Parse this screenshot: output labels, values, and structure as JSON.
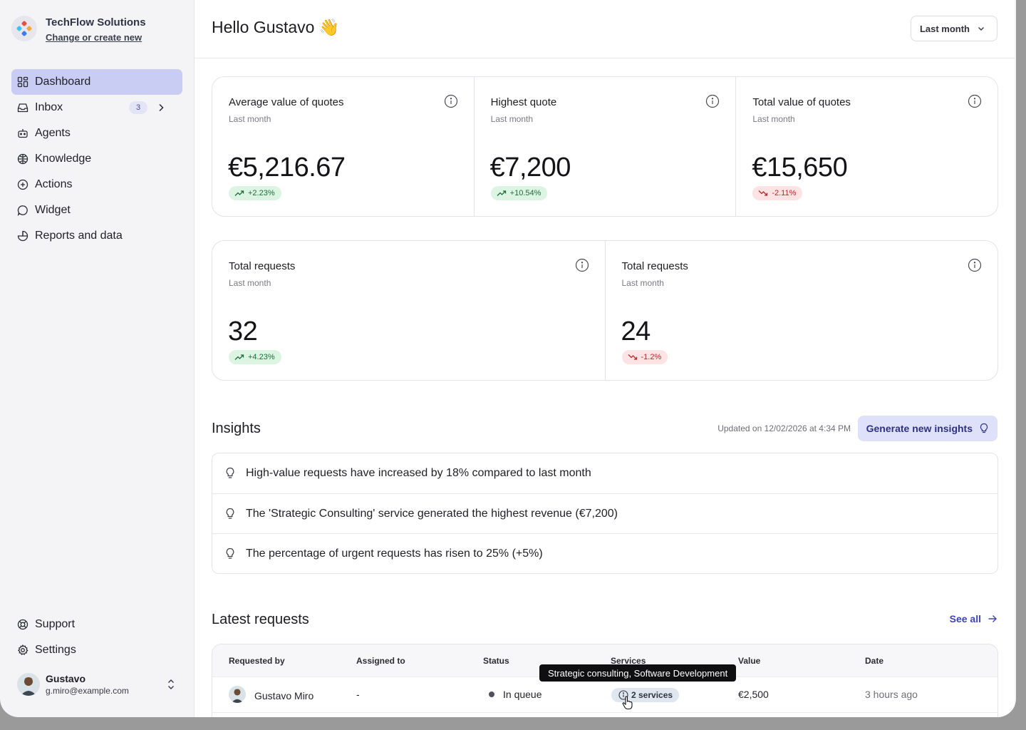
{
  "org": {
    "name": "TechFlow Solutions",
    "change_link": "Change or create new"
  },
  "nav": {
    "items": [
      {
        "label": "Dashboard",
        "icon": "dashboard-icon",
        "active": true
      },
      {
        "label": "Inbox",
        "icon": "inbox-icon",
        "badge": "3"
      },
      {
        "label": "Agents",
        "icon": "agents-icon"
      },
      {
        "label": "Knowledge",
        "icon": "knowledge-icon"
      },
      {
        "label": "Actions",
        "icon": "plus-circle-icon"
      },
      {
        "label": "Widget",
        "icon": "chat-bubble-icon"
      },
      {
        "label": "Reports and data",
        "icon": "pie-chart-icon"
      }
    ],
    "bottom": [
      {
        "label": "Support",
        "icon": "support-icon"
      },
      {
        "label": "Settings",
        "icon": "gear-icon"
      }
    ]
  },
  "user": {
    "name": "Gustavo",
    "email": "g.miro@example.com"
  },
  "header": {
    "greeting": "Hello Gustavo",
    "wave": "👋",
    "period": "Last month"
  },
  "kpis_top": [
    {
      "title": "Average value of quotes",
      "sub": "Last month",
      "value": "€5,216.67",
      "delta": "+2.23%",
      "trend": "up"
    },
    {
      "title": "Highest quote",
      "sub": "Last month",
      "value": "€7,200",
      "delta": "+10.54%",
      "trend": "up"
    },
    {
      "title": "Total value of quotes",
      "sub": "Last month",
      "value": "€15,650",
      "delta": "-2.11%",
      "trend": "down"
    }
  ],
  "kpis_bottom": [
    {
      "title": "Total requests",
      "sub": "Last month",
      "value": "32",
      "delta": "+4.23%",
      "trend": "up"
    },
    {
      "title": "Total requests",
      "sub": "Last month",
      "value": "24",
      "delta": "-1.2%",
      "trend": "down"
    }
  ],
  "insights": {
    "title": "Insights",
    "updated": "Updated on 12/02/2026 at 4:34 PM",
    "generate_label": "Generate new insights",
    "items": [
      "High-value requests have increased by 18% compared to last month",
      "The 'Strategic Consulting' service generated the highest revenue (€7,200)",
      "The percentage of urgent requests has risen to 25% (+5%)"
    ]
  },
  "requests": {
    "title": "Latest requests",
    "see_all": "See all",
    "columns": [
      "Requested by",
      "Assigned to",
      "Status",
      "Services",
      "Value",
      "Date"
    ],
    "rows": [
      {
        "requested_by": "Gustavo Miro",
        "assigned_to": "-",
        "status": "In queue",
        "services": "2 services",
        "value": "€2,500",
        "date": "3 hours ago"
      }
    ],
    "tooltip": "Strategic consulting, Software Development"
  },
  "colors": {
    "accent": "#3e44b5",
    "active_nav": "#c9ccf3",
    "up": "#1f6b3a",
    "down": "#b52a2a"
  }
}
